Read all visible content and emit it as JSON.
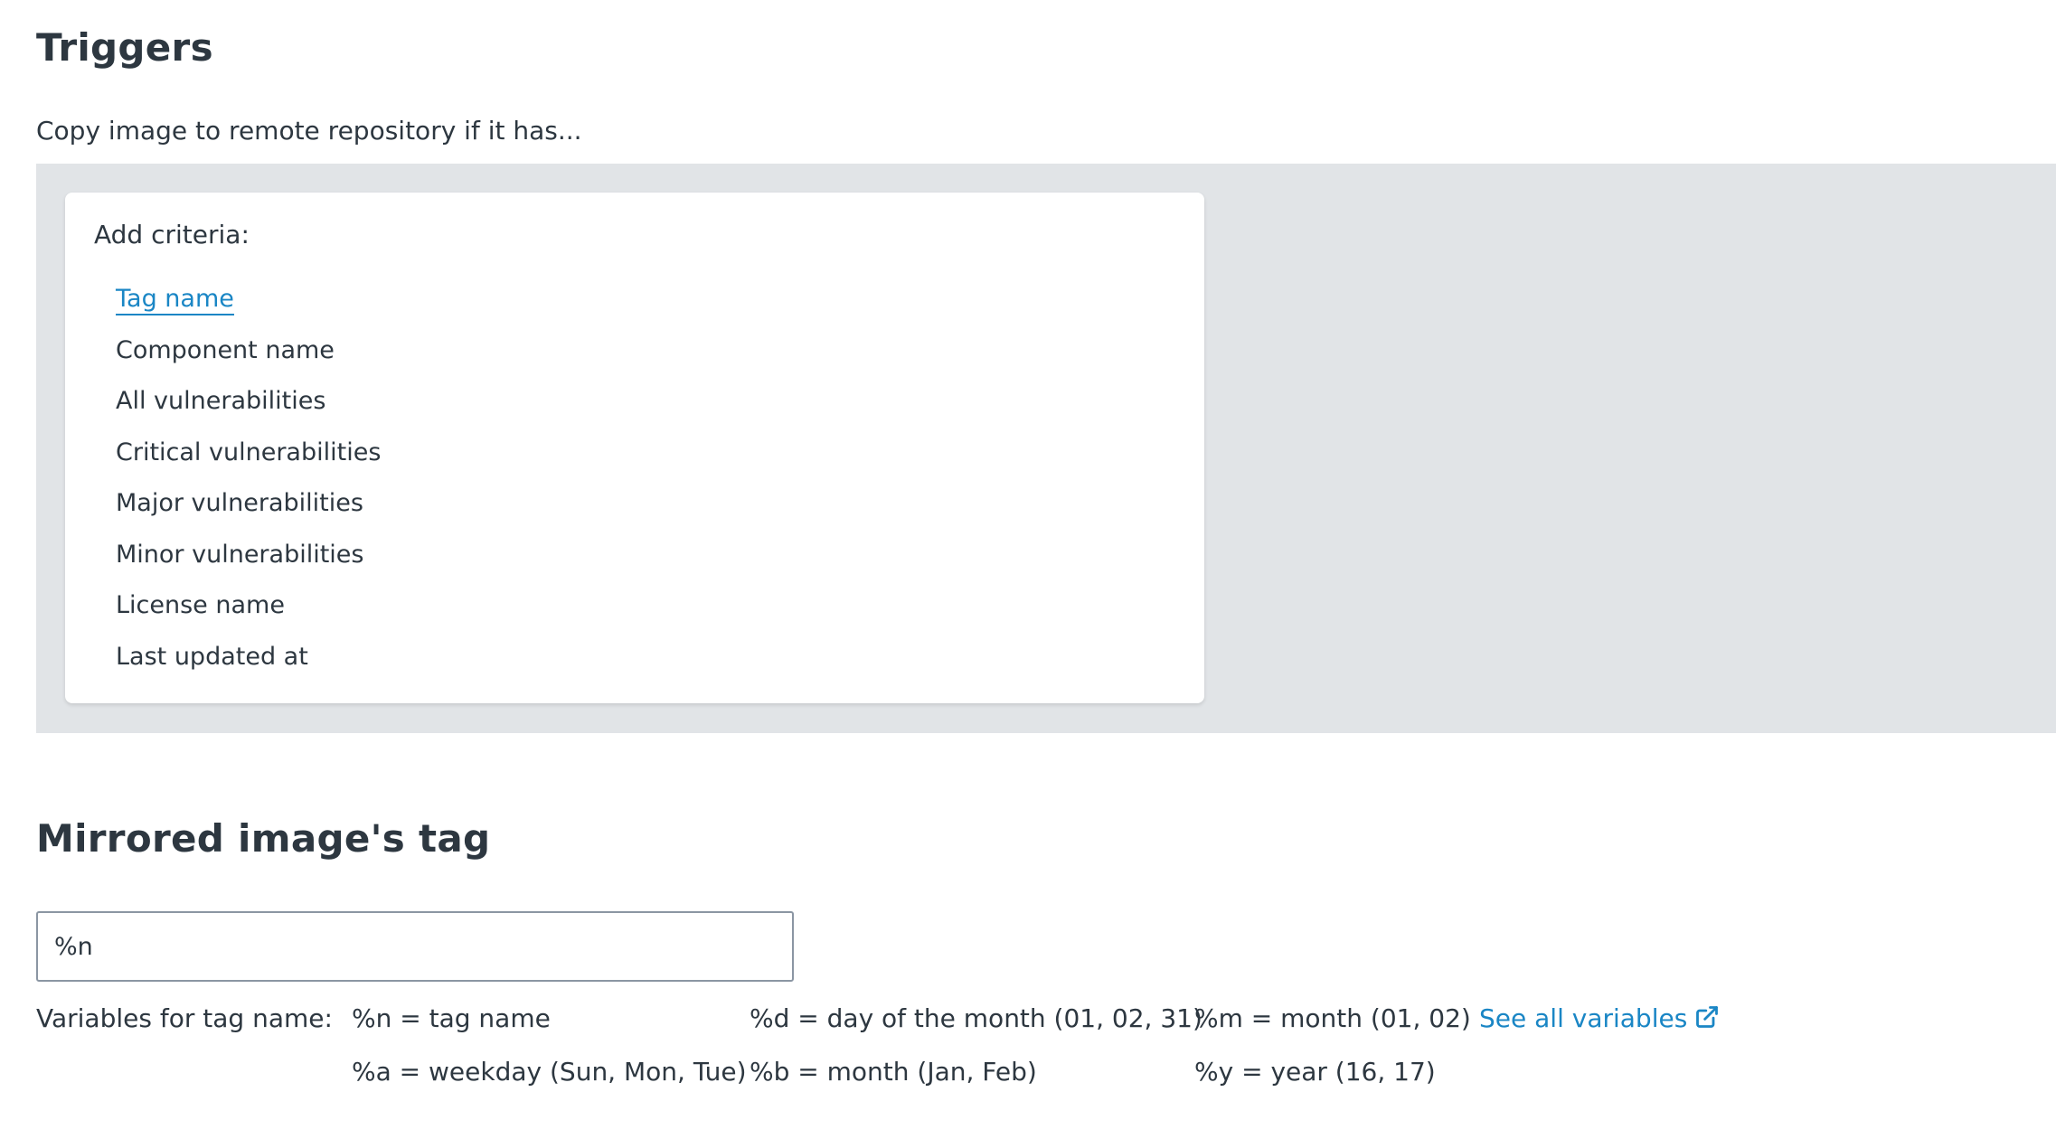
{
  "triggers": {
    "title": "Triggers",
    "subtitle": "Copy image to remote repository if it has..."
  },
  "criteria": {
    "heading": "Add criteria:",
    "items": [
      "Tag name",
      "Component name",
      "All vulnerabilities",
      "Critical vulnerabilities",
      "Major vulnerabilities",
      "Minor vulnerabilities",
      "License name",
      "Last updated at"
    ],
    "active_index": 0
  },
  "mirrored": {
    "title": "Mirrored image's tag",
    "input_value": "%n",
    "variables_label": "Variables for tag name:",
    "variables": [
      "%n = tag name",
      "%d = day of the month (01, 02, 31)",
      "%m = month (01, 02)",
      "%a = weekday (Sun, Mon, Tue)",
      "%b = month (Jan, Feb)",
      "%y = year (16, 17)"
    ],
    "see_all_link": "See all variables"
  },
  "colors": {
    "link": "#1a86c5",
    "panel_bg": "#e1e4e7",
    "text": "#2d3740"
  },
  "icons": {
    "see_all": "external-link-icon"
  }
}
